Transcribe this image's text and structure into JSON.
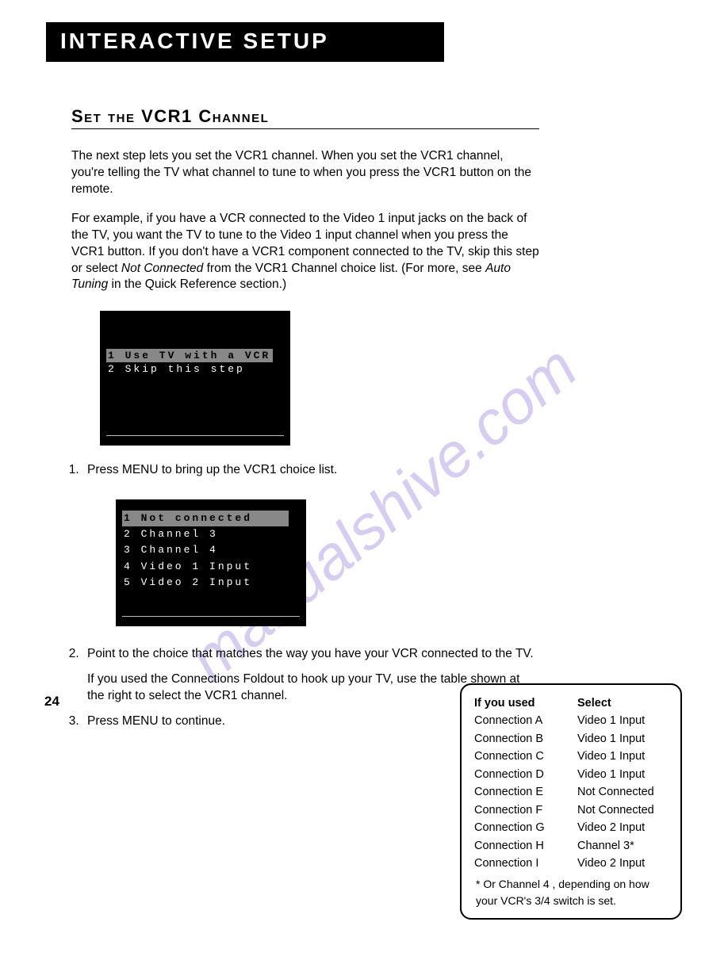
{
  "banner": "Interactive Setup",
  "heading": "Set the VCR1 Channel",
  "para1": "The next step lets you set the VCR1 channel. When you set the VCR1 channel, you're telling the TV what channel to tune to when you press the VCR1 button on the remote.",
  "para2a": "For example, if you have a VCR connected to the Video 1 input jacks on the back of the TV, you want the TV to tune to the Video 1 input channel when you press the VCR1 button. If you don't have a VCR1 component connected to the TV, skip this step or select ",
  "para2_not": "Not Connected",
  "para2b": " from the VCR1 Channel choice list. (For more, see ",
  "para2_auto": "Auto Tuning",
  "para2c": " in the Quick Reference section.)",
  "screen1": {
    "hl": "1 Use TV with a VCR",
    "r2": "2 Skip this step"
  },
  "step1": "Press MENU to bring up the VCR1 choice list.",
  "screen2": {
    "hl": "1 Not connected",
    "r2": "2 Channel 3",
    "r3": "3 Channel 4",
    "r4": "4 Video 1 Input",
    "r5": "5 Video 2 Input"
  },
  "step2a": "Point to the choice that matches the way you have your VCR connected to the TV.",
  "step2b": "If you used the Connections Foldout to hook up your TV, use the table shown at the right to select the VCR1 channel.",
  "step3": "Press MENU to continue.",
  "table": {
    "h1": "If you used",
    "h2": "Select",
    "rows": [
      {
        "a": "Connection A",
        "b": "Video 1 Input"
      },
      {
        "a": "Connection B",
        "b": "Video 1 Input"
      },
      {
        "a": "Connection C",
        "b": "Video 1 Input"
      },
      {
        "a": "Connection D",
        "b": "Video 1 Input"
      },
      {
        "a": "Connection E",
        "b": "Not Connected"
      },
      {
        "a": "Connection F",
        "b": "Not Connected"
      },
      {
        "a": "Connection G",
        "b": "Video 2 Input"
      },
      {
        "a": "Connection H",
        "b": "Channel 3*"
      },
      {
        "a": "Connection I",
        "b": "Video 2 Input"
      }
    ],
    "footnote": "* Or Channel 4 , depending on how your VCR's 3/4 switch is set."
  },
  "pagenum": "24",
  "watermark_text": "manualshive.com"
}
